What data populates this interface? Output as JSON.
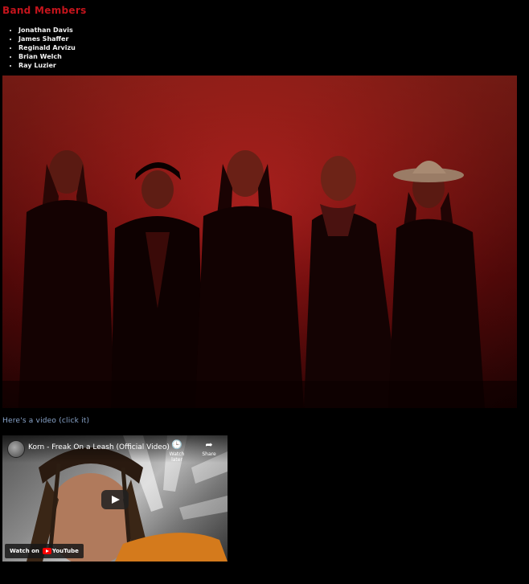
{
  "heading": "Band Members",
  "members": [
    "Jonathan Davis",
    "James Shaffer",
    "Reginald Arvizu",
    "Brian Welch",
    "Ray Luzier"
  ],
  "video_link_text": "Here's a video (click it)",
  "video": {
    "title": "Korn - Freak On a Leash (Official Video)",
    "watch_later_label": "Watch later",
    "share_label": "Share",
    "watch_on_label": "Watch on",
    "youtube_label": "YouTube"
  }
}
